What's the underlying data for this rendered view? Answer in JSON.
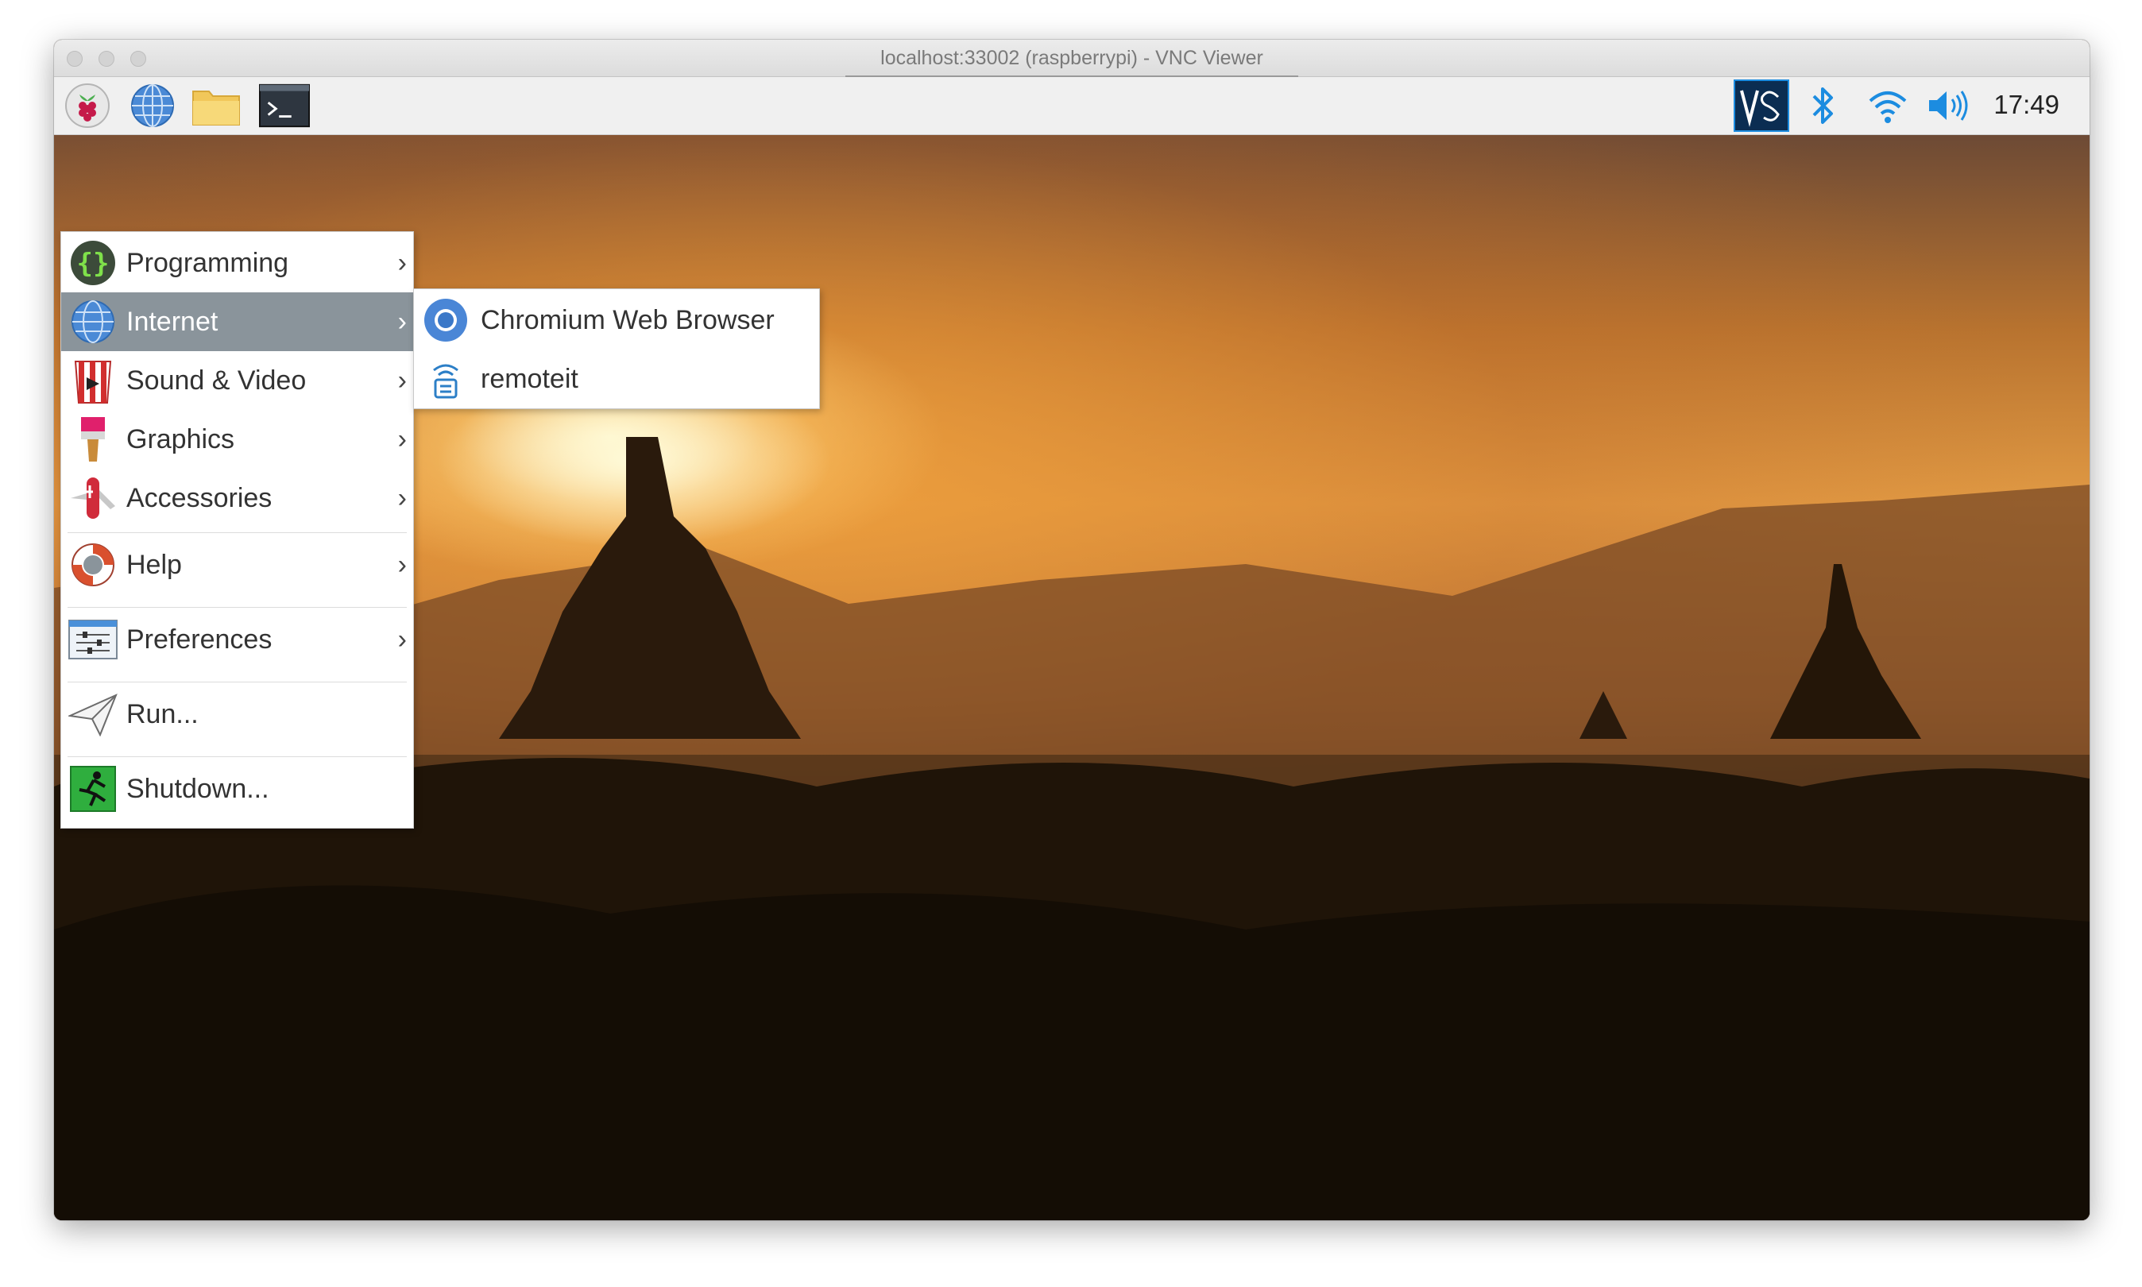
{
  "window": {
    "title": "localhost:33002 (raspberrypi) - VNC Viewer"
  },
  "taskbar": {
    "launchers": [
      {
        "icon": "raspberry-pi-menu-icon"
      },
      {
        "icon": "web-browser-icon"
      },
      {
        "icon": "file-manager-icon"
      },
      {
        "icon": "terminal-icon"
      }
    ],
    "tray": [
      {
        "icon": "vnc-server-icon"
      },
      {
        "icon": "bluetooth-icon"
      },
      {
        "icon": "wifi-icon"
      },
      {
        "icon": "volume-icon"
      }
    ],
    "clock": "17:49"
  },
  "main_menu": {
    "items": [
      {
        "label": "Programming",
        "icon": "programming-icon",
        "has_submenu": true
      },
      {
        "label": "Internet",
        "icon": "internet-globe-icon",
        "has_submenu": true,
        "active": true
      },
      {
        "label": "Sound & Video",
        "icon": "sound-video-icon",
        "has_submenu": true
      },
      {
        "label": "Graphics",
        "icon": "graphics-brush-icon",
        "has_submenu": true
      },
      {
        "label": "Accessories",
        "icon": "accessories-knife-icon",
        "has_submenu": true
      },
      {
        "label": "Help",
        "icon": "help-lifebuoy-icon",
        "has_submenu": true
      },
      {
        "label": "Preferences",
        "icon": "preferences-icon",
        "has_submenu": true
      },
      {
        "label": "Run...",
        "icon": "run-paper-plane-icon",
        "has_submenu": false
      },
      {
        "label": "Shutdown...",
        "icon": "shutdown-exit-icon",
        "has_submenu": false
      }
    ],
    "arrow": "›"
  },
  "internet_submenu": {
    "items": [
      {
        "label": "Chromium Web Browser",
        "icon": "chromium-icon"
      },
      {
        "label": "remoteit",
        "icon": "remoteit-icon"
      }
    ]
  },
  "colors": {
    "menu_active_bg": "#8a949b",
    "tray_blue": "#1c8ce0"
  }
}
